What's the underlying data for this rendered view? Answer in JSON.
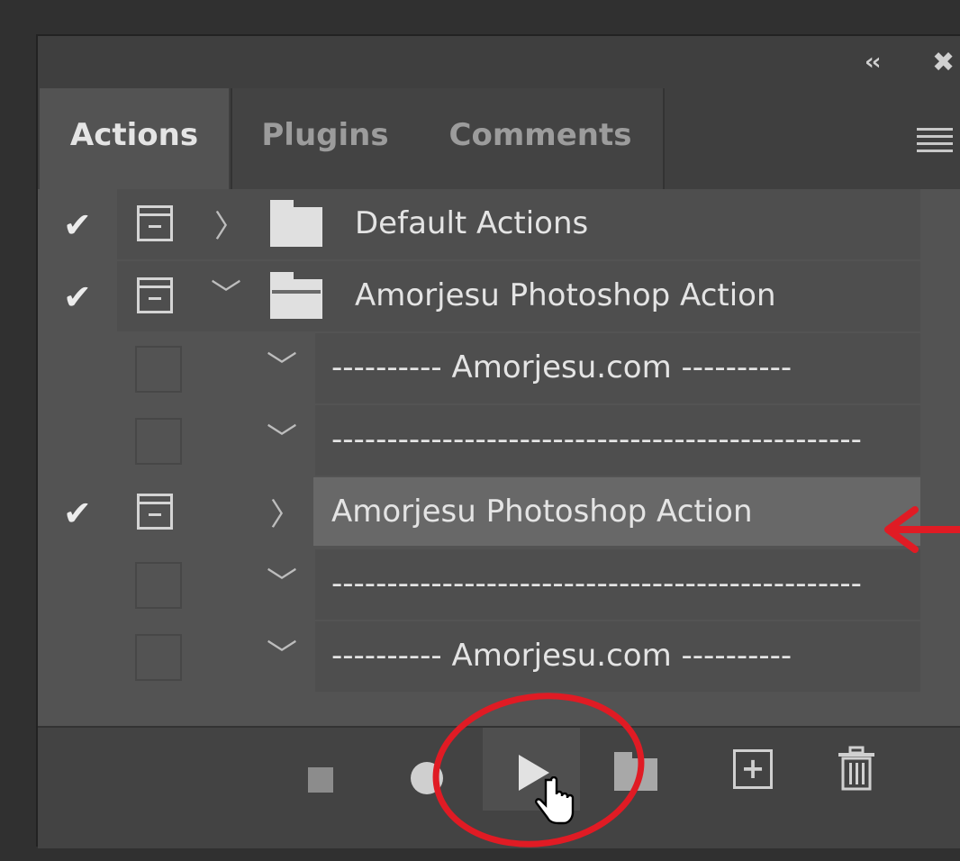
{
  "panel": {
    "collapse_icon": "double-chevron-left-icon",
    "close_icon": "close-icon",
    "menu_icon": "panel-menu-icon"
  },
  "tabs": [
    {
      "label": "Actions",
      "active": true
    },
    {
      "label": "Plugins",
      "active": false
    },
    {
      "label": "Comments",
      "active": false
    }
  ],
  "actions": [
    {
      "label": "Default Actions",
      "checked": true,
      "dialog": true,
      "expanded": false,
      "type": "set"
    },
    {
      "label": "Amorjesu Photoshop Action",
      "checked": true,
      "dialog": true,
      "expanded": true,
      "type": "set"
    },
    {
      "label": "---------- Amorjesu.com ----------",
      "checked": false,
      "dialog": false,
      "expanded": true,
      "type": "action"
    },
    {
      "label": "------------------------------------------------",
      "checked": false,
      "dialog": false,
      "expanded": true,
      "type": "action"
    },
    {
      "label": "Amorjesu Photoshop Action",
      "checked": true,
      "dialog": true,
      "expanded": false,
      "type": "action",
      "selected": true
    },
    {
      "label": "------------------------------------------------",
      "checked": false,
      "dialog": false,
      "expanded": true,
      "type": "action"
    },
    {
      "label": "---------- Amorjesu.com ----------",
      "checked": false,
      "dialog": false,
      "expanded": true,
      "type": "action"
    }
  ],
  "footer": {
    "buttons": [
      "stop-icon",
      "record-icon",
      "play-icon",
      "new-set-icon",
      "new-action-icon",
      "trash-icon"
    ]
  },
  "annotation_color": "#e01b24"
}
